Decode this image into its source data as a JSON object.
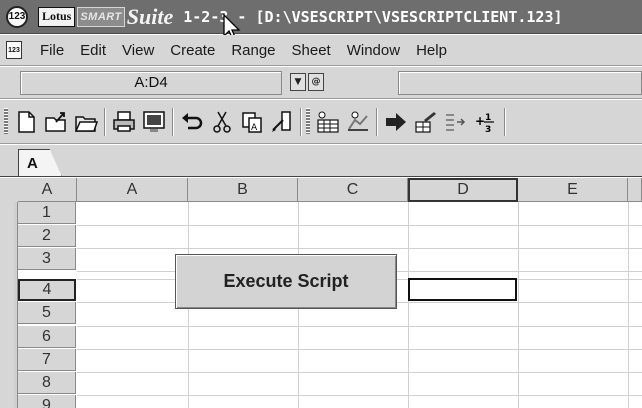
{
  "titlebar": {
    "app_icon": "123",
    "lotus_logo": "Lotus",
    "smart_text": "SMART",
    "suite_text": "Suite",
    "title": "1-2-3 - [D:\\VSESCRIPT\\VSESCRIPTCLIENT.123]",
    "cursor": "arrow-pointer-icon"
  },
  "menubar": {
    "doc_icon": "123",
    "items": [
      "File",
      "Edit",
      "View",
      "Create",
      "Range",
      "Sheet",
      "Window",
      "Help"
    ]
  },
  "formulabar": {
    "cell_address": "A:D4",
    "formula_contents": ""
  },
  "toolbar": {
    "icons": [
      "new-document-icon",
      "open-file-icon",
      "open-folder-icon",
      "print-icon",
      "print-preview-icon",
      "undo-icon",
      "cut-icon",
      "copy-icon",
      "paste-icon",
      "insert-row-icon",
      "insert-chart-icon",
      "arrow-right-icon",
      "fill-range-icon",
      "sort-icon",
      "fraction-icon"
    ],
    "fraction_label": "+1/2/3"
  },
  "sheet_tab": {
    "label": "A"
  },
  "grid": {
    "corner_label": "A",
    "columns": [
      "A",
      "B",
      "C",
      "D",
      "E"
    ],
    "rows": [
      "1",
      "2",
      "3",
      "4",
      "5",
      "6",
      "7",
      "8",
      "9"
    ],
    "active_row": "4",
    "active_column": "D"
  },
  "execute_button": {
    "label": "Execute Script"
  },
  "colors": {
    "titlebar_bg": "#6e6e6e",
    "chrome_bg": "#d6d6d6",
    "grid_line": "#d0d0d0"
  }
}
